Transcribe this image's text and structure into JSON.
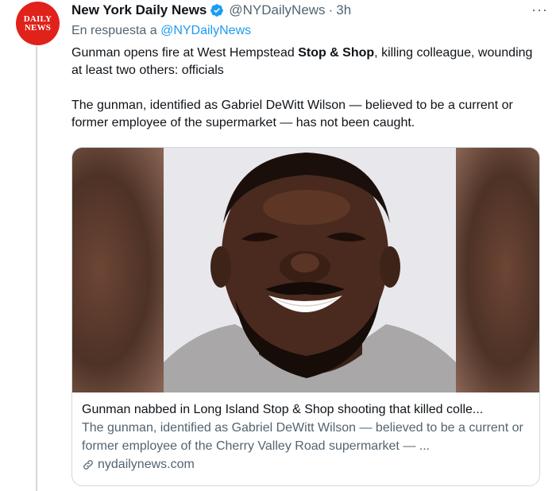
{
  "account": {
    "name": "New York Daily News",
    "handle": "@NYDailyNews",
    "separator": "·",
    "time": "3h",
    "avatar_line1": "DAILY",
    "avatar_line2": "NEWS",
    "more_label": "···"
  },
  "reply": {
    "prefix": "En respuesta a",
    "mention": "@NYDailyNews"
  },
  "tweet": {
    "line1_before": "Gunman opens fire at West Hempstead ",
    "line1_bold": "Stop & Shop",
    "line1_after": ", killing colleague, wounding at least two others: officials",
    "paragraph2": "The gunman, identified as Gabriel DeWitt Wilson — believed to be a current or former employee of the supermarket — has not been caught."
  },
  "card": {
    "title": "Gunman nabbed in Long Island Stop & Shop shooting that killed colle...",
    "description": "The gunman, identified as Gabriel DeWitt Wilson — believed to be a current or former employee of the Cherry Valley Road supermarket — ...",
    "domain": "nydailynews.com",
    "image_icon": "portrait-photo"
  },
  "colors": {
    "brand_red": "#e0221b",
    "link_blue": "#1d9bf0",
    "muted": "#536471",
    "border": "#cfd9de"
  }
}
